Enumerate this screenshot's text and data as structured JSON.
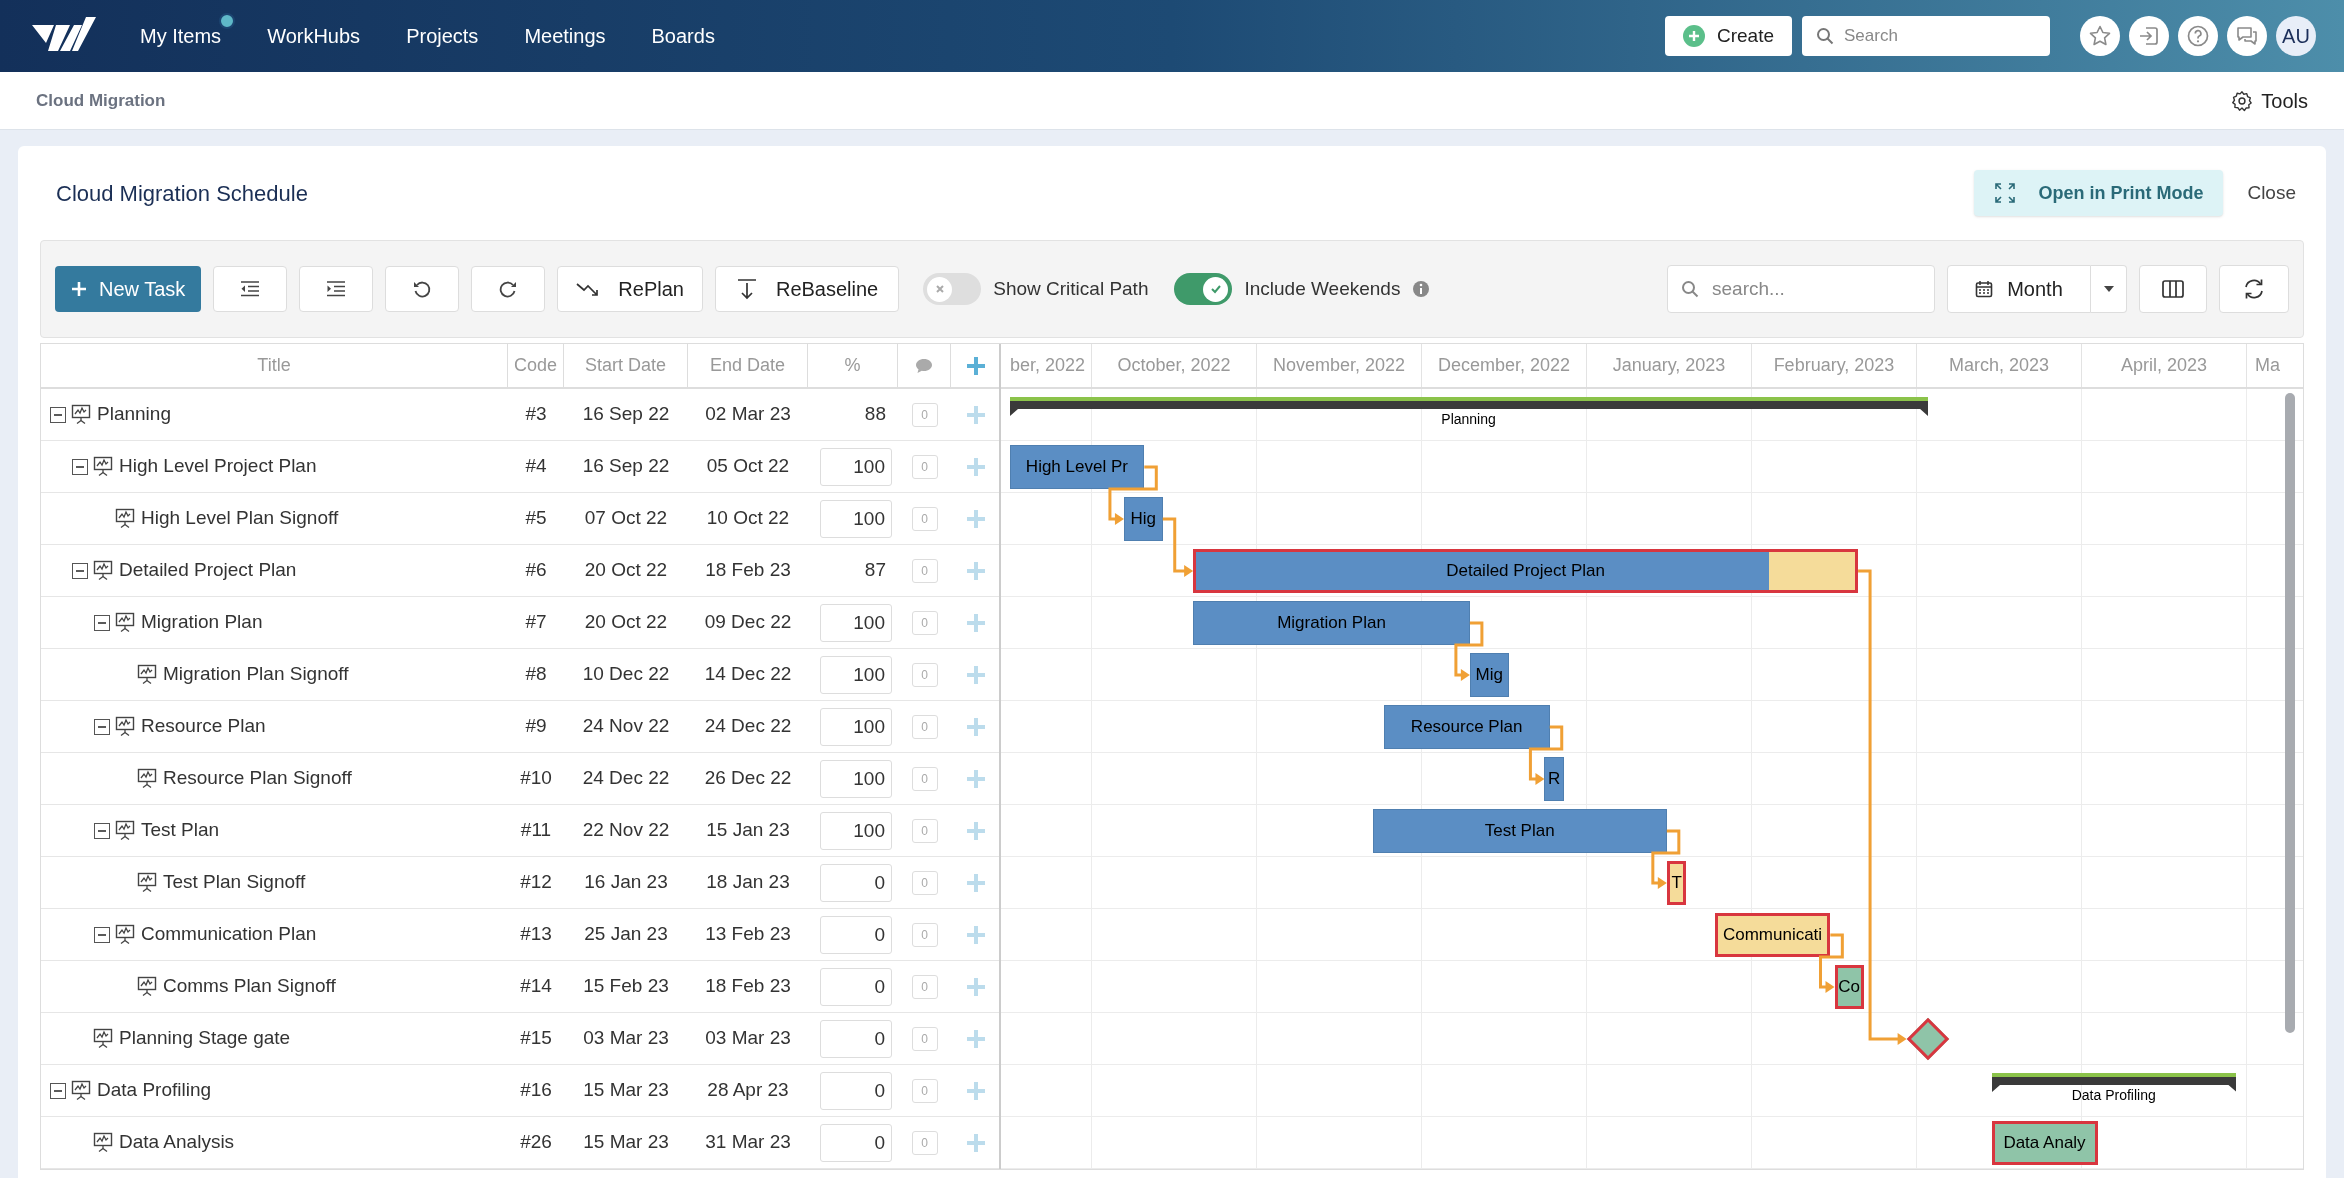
{
  "nav": {
    "items": [
      {
        "label": "My Items",
        "badge": true
      },
      {
        "label": "WorkHubs",
        "badge": false
      },
      {
        "label": "Projects",
        "badge": false
      },
      {
        "label": "Meetings",
        "badge": false
      },
      {
        "label": "Boards",
        "badge": false
      }
    ],
    "create_label": "Create",
    "search_placeholder": "Search",
    "avatar": "AU"
  },
  "breadcrumb": "Cloud Migration",
  "tools_label": "Tools",
  "card": {
    "title": "Cloud Migration Schedule",
    "print_button": "Open in Print Mode",
    "close_button": "Close"
  },
  "toolbar": {
    "new_task": "New Task",
    "replan": "RePlan",
    "rebaseline": "ReBaseline",
    "toggles": [
      {
        "label": "Show Critical Path",
        "on": false
      },
      {
        "label": "Include Weekends",
        "on": true,
        "info": true
      }
    ],
    "search_placeholder": "search...",
    "view": "Month"
  },
  "table": {
    "columns": [
      "Title",
      "Code",
      "Start Date",
      "End Date",
      "%"
    ],
    "rows": [
      {
        "title": "Planning",
        "code": "#3",
        "start": "16 Sep 22",
        "end": "02 Mar 23",
        "percent": "88",
        "percent_editable": false,
        "comments": "0",
        "expanded": true,
        "bar": {
          "kind": "summary",
          "label": "Planning"
        },
        "children": [
          {
            "title": "High Level Project Plan",
            "code": "#4",
            "start": "16 Sep 22",
            "end": "05 Oct 22",
            "percent": "100",
            "percent_editable": true,
            "comments": "0",
            "expanded": true,
            "bar": {
              "kind": "task",
              "label": "High Level Pr",
              "critical": false,
              "link_next": true
            },
            "children": [
              {
                "title": "High Level Plan Signoff",
                "code": "#5",
                "start": "07 Oct 22",
                "end": "10 Oct 22",
                "percent": "100",
                "percent_editable": true,
                "comments": "0",
                "bar": {
                  "kind": "task",
                  "label": "Hig",
                  "critical": false,
                  "link_next": true
                }
              }
            ]
          },
          {
            "title": "Detailed Project Plan",
            "code": "#6",
            "start": "20 Oct 22",
            "end": "18 Feb 23",
            "percent": "87",
            "percent_editable": false,
            "comments": "0",
            "expanded": true,
            "bar": {
              "kind": "task",
              "label": "Detailed Project Plan",
              "level": 0.87,
              "color": "#f5dc9a",
              "critical": true,
              "link_next_sibling": true
            },
            "children": [
              {
                "title": "Migration Plan",
                "code": "#7",
                "start": "20 Oct 22",
                "end": "09 Dec 22",
                "percent": "100",
                "percent_editable": true,
                "comments": "0",
                "expanded": true,
                "bar": {
                  "kind": "task",
                  "label": "Migration Plan",
                  "critical": false,
                  "link_next": true
                },
                "children": [
                  {
                    "title": "Migration Plan Signoff",
                    "code": "#8",
                    "start": "10 Dec 22",
                    "end": "14 Dec 22",
                    "percent": "100",
                    "percent_editable": true,
                    "comments": "0",
                    "bar": {
                      "kind": "task",
                      "label": "Mig",
                      "critical": false
                    }
                  }
                ]
              },
              {
                "title": "Resource Plan",
                "code": "#9",
                "start": "24 Nov 22",
                "end": "24 Dec 22",
                "percent": "100",
                "percent_editable": true,
                "comments": "0",
                "expanded": true,
                "bar": {
                  "kind": "task",
                  "label": "Resource Plan",
                  "critical": false,
                  "link_next": true
                },
                "children": [
                  {
                    "title": "Resource Plan Signoff",
                    "code": "#10",
                    "start": "24 Dec 22",
                    "end": "26 Dec 22",
                    "percent": "100",
                    "percent_editable": true,
                    "comments": "0",
                    "bar": {
                      "kind": "task",
                      "label": "R",
                      "critical": false
                    }
                  }
                ]
              },
              {
                "title": "Test Plan",
                "code": "#11",
                "start": "22 Nov 22",
                "end": "15 Jan 23",
                "percent": "100",
                "percent_editable": true,
                "comments": "0",
                "expanded": true,
                "bar": {
                  "kind": "task",
                  "label": "Test Plan",
                  "critical": false,
                  "link_next": true
                },
                "children": [
                  {
                    "title": "Test Plan Signoff",
                    "code": "#12",
                    "start": "16 Jan 23",
                    "end": "18 Jan 23",
                    "percent": "0",
                    "percent_editable": true,
                    "comments": "0",
                    "bar": {
                      "kind": "task",
                      "label": "T",
                      "color": "#f5dc9a",
                      "critical": true
                    }
                  }
                ]
              },
              {
                "title": "Communication Plan",
                "code": "#13",
                "start": "25 Jan 23",
                "end": "13 Feb 23",
                "percent": "0",
                "percent_editable": true,
                "comments": "0",
                "expanded": true,
                "bar": {
                  "kind": "task",
                  "label": "Communicati",
                  "color": "#f5dc9a",
                  "critical": true,
                  "link_next": true
                },
                "children": [
                  {
                    "title": "Comms Plan Signoff",
                    "code": "#14",
                    "start": "15 Feb 23",
                    "end": "18 Feb 23",
                    "percent": "0",
                    "percent_editable": true,
                    "comments": "0",
                    "bar": {
                      "kind": "task",
                      "label": "Co",
                      "color": "#8fc4a8",
                      "critical": true
                    }
                  }
                ]
              }
            ]
          },
          {
            "title": "Planning Stage gate",
            "code": "#15",
            "start": "03 Mar 23",
            "end": "03 Mar 23",
            "percent": "0",
            "percent_editable": true,
            "comments": "0",
            "bar": {
              "kind": "milestone",
              "color": "#8fc4a8",
              "critical": true
            }
          }
        ]
      },
      {
        "title": "Data Profiling",
        "code": "#16",
        "start": "15 Mar 23",
        "end": "28 Apr 23",
        "percent": "0",
        "percent_editable": true,
        "comments": "0",
        "expanded": true,
        "bar": {
          "kind": "summary",
          "label": "Data Profiling"
        },
        "children": [
          {
            "title": "Data Analysis",
            "code": "#26",
            "start": "15 Mar 23",
            "end": "31 Mar 23",
            "percent": "0",
            "percent_editable": true,
            "comments": "0",
            "bar": {
              "kind": "task",
              "label": "Data Analy",
              "color": "#8fc4a8",
              "critical": true
            }
          }
        ]
      }
    ]
  },
  "gantt": {
    "months": [
      "ber, 2022",
      "October, 2022",
      "November, 2022",
      "December, 2022",
      "January, 2023",
      "February, 2023",
      "March, 2023",
      "April, 2023",
      "Ma"
    ]
  }
}
